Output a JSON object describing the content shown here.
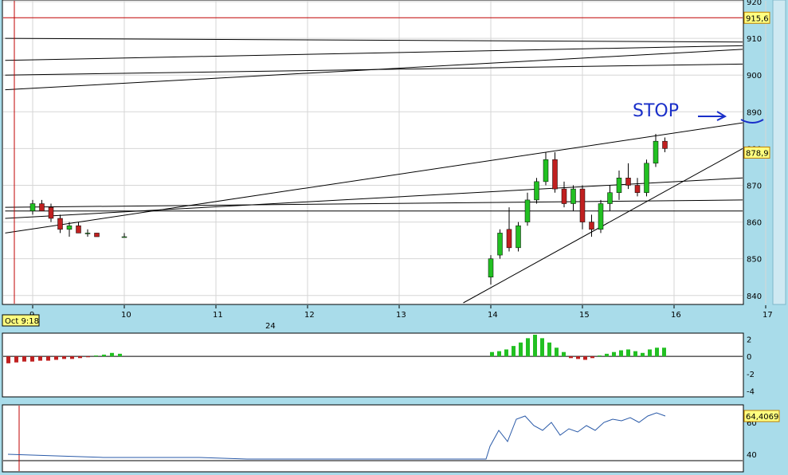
{
  "chart_data": [
    {
      "type": "candlestick",
      "title": "",
      "x_ticks": [
        "9",
        "10",
        "11",
        "12",
        "13",
        "14",
        "15",
        "16",
        "17"
      ],
      "x_secondary_label": "24",
      "cursor_label": "Oct 9:18",
      "y_ticks": [
        840,
        850,
        860,
        870,
        880,
        890,
        900,
        910,
        920
      ],
      "y_range": [
        838,
        920
      ],
      "price_tags": [
        "915,6",
        "878,9"
      ],
      "grid": true,
      "candles": [
        {
          "t": 9.0,
          "o": 863,
          "h": 866,
          "l": 862,
          "c": 865
        },
        {
          "t": 9.1,
          "o": 865,
          "h": 866,
          "l": 864,
          "c": 863
        },
        {
          "t": 9.2,
          "o": 864,
          "h": 865,
          "l": 860,
          "c": 861
        },
        {
          "t": 9.3,
          "o": 861,
          "h": 862,
          "l": 857,
          "c": 858
        },
        {
          "t": 9.4,
          "o": 858,
          "h": 860,
          "l": 856,
          "c": 859
        },
        {
          "t": 9.5,
          "o": 859,
          "h": 860,
          "l": 857,
          "c": 857
        },
        {
          "t": 9.6,
          "o": 857,
          "h": 858,
          "l": 856,
          "c": 857
        },
        {
          "t": 9.7,
          "o": 857,
          "h": 857,
          "l": 856,
          "c": 856
        },
        {
          "t": 10.0,
          "o": 856,
          "h": 857,
          "l": 856,
          "c": 856
        },
        {
          "t": 14.0,
          "o": 845,
          "h": 851,
          "l": 843,
          "c": 850
        },
        {
          "t": 14.1,
          "o": 851,
          "h": 858,
          "l": 850,
          "c": 857
        },
        {
          "t": 14.2,
          "o": 858,
          "h": 864,
          "l": 852,
          "c": 853
        },
        {
          "t": 14.3,
          "o": 853,
          "h": 860,
          "l": 852,
          "c": 859
        },
        {
          "t": 14.4,
          "o": 860,
          "h": 868,
          "l": 859,
          "c": 866
        },
        {
          "t": 14.5,
          "o": 866,
          "h": 872,
          "l": 865,
          "c": 871
        },
        {
          "t": 14.6,
          "o": 871,
          "h": 879,
          "l": 870,
          "c": 877
        },
        {
          "t": 14.7,
          "o": 877,
          "h": 879,
          "l": 868,
          "c": 869
        },
        {
          "t": 14.8,
          "o": 869,
          "h": 871,
          "l": 864,
          "c": 865
        },
        {
          "t": 14.9,
          "o": 865,
          "h": 870,
          "l": 863,
          "c": 869
        },
        {
          "t": 15.0,
          "o": 869,
          "h": 870,
          "l": 858,
          "c": 860
        },
        {
          "t": 15.1,
          "o": 860,
          "h": 862,
          "l": 856,
          "c": 858
        },
        {
          "t": 15.2,
          "o": 858,
          "h": 866,
          "l": 857,
          "c": 865
        },
        {
          "t": 15.3,
          "o": 865,
          "h": 870,
          "l": 863,
          "c": 868
        },
        {
          "t": 15.4,
          "o": 868,
          "h": 874,
          "l": 866,
          "c": 872
        },
        {
          "t": 15.5,
          "o": 872,
          "h": 876,
          "l": 869,
          "c": 870
        },
        {
          "t": 15.6,
          "o": 870,
          "h": 872,
          "l": 867,
          "c": 868
        },
        {
          "t": 15.7,
          "o": 868,
          "h": 877,
          "l": 867,
          "c": 876
        },
        {
          "t": 15.8,
          "o": 876,
          "h": 884,
          "l": 875,
          "c": 882
        },
        {
          "t": 15.9,
          "o": 882,
          "h": 883,
          "l": 879,
          "c": 880
        }
      ],
      "lines": [
        {
          "x1": 8.7,
          "y1": 896,
          "x2": 17.3,
          "y2": 907
        },
        {
          "x1": 8.7,
          "y1": 900,
          "x2": 17.3,
          "y2": 903
        },
        {
          "x1": 8.7,
          "y1": 904,
          "x2": 17.3,
          "y2": 908
        },
        {
          "x1": 8.7,
          "y1": 910,
          "x2": 17.3,
          "y2": 909
        },
        {
          "x1": 8.7,
          "y1": 857,
          "x2": 17.3,
          "y2": 887
        },
        {
          "x1": 8.7,
          "y1": 861,
          "x2": 17.3,
          "y2": 872
        },
        {
          "x1": 8.7,
          "y1": 864,
          "x2": 17.3,
          "y2": 866
        },
        {
          "x1": 8.7,
          "y1": 863,
          "x2": 17.3,
          "y2": 863
        },
        {
          "x1": 13.7,
          "y1": 838,
          "x2": 17.3,
          "y2": 880
        }
      ],
      "hlines": [
        915.6
      ],
      "annotation": "STOP"
    },
    {
      "type": "bar",
      "y_ticks": [
        "2",
        "0",
        "-2",
        "-4"
      ],
      "y_range": [
        -4.5,
        2.5
      ],
      "values": [
        -0.8,
        -0.7,
        -0.6,
        -0.6,
        -0.5,
        -0.5,
        -0.4,
        -0.3,
        -0.3,
        -0.2,
        -0.1,
        0.1,
        0.2,
        0.4,
        0.3,
        0.5,
        0.6,
        0.8,
        1.2,
        1.6,
        2.1,
        2.5,
        2.1,
        1.6,
        1.0,
        0.5,
        -0.2,
        -0.3,
        -0.4,
        -0.2,
        0.1,
        0.3,
        0.5,
        0.7,
        0.8,
        0.6,
        0.4,
        0.8,
        1.0,
        1.0
      ]
    },
    {
      "type": "line",
      "y_ticks": [
        "60",
        "40"
      ],
      "y_range": [
        30,
        70
      ],
      "price_tag": "64,4069",
      "values": [
        40,
        39,
        38,
        38,
        38,
        37,
        37,
        37,
        37,
        37,
        37,
        45,
        55,
        48,
        62,
        64,
        58,
        55,
        60,
        52,
        56,
        54,
        58,
        55,
        60,
        62,
        61,
        63,
        60,
        64,
        66,
        64
      ]
    }
  ]
}
